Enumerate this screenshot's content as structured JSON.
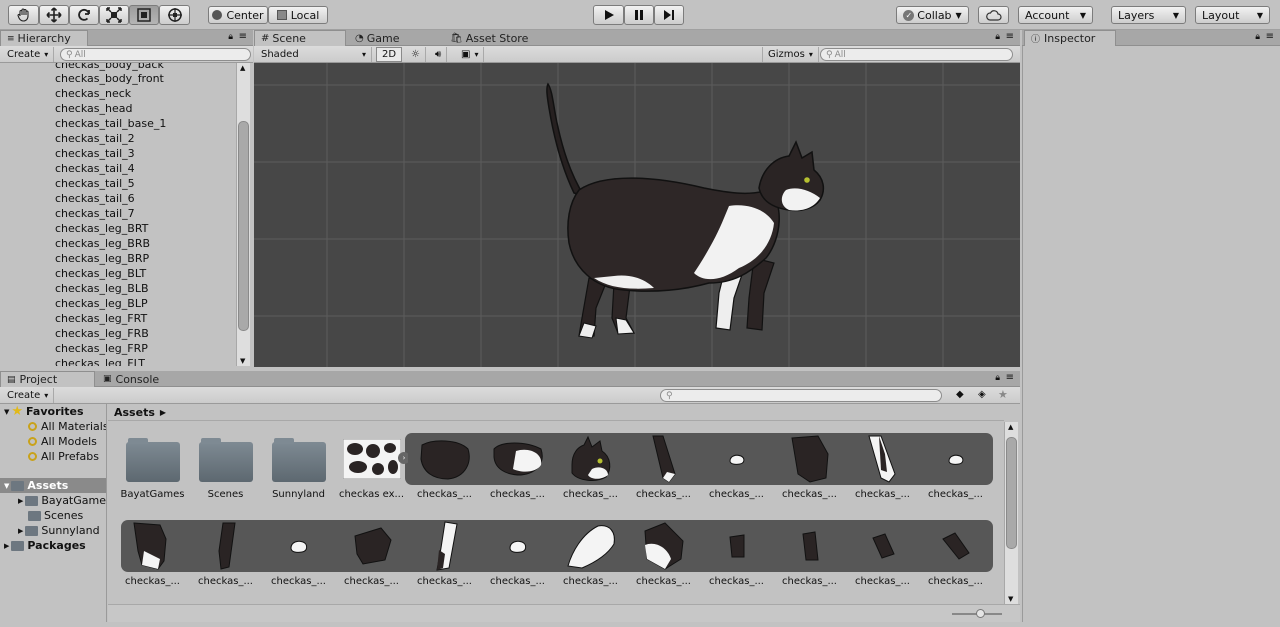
{
  "toolbar": {
    "pivot_label": "Center",
    "space_label": "Local",
    "collab_label": "Collab",
    "account_label": "Account",
    "layers_label": "Layers",
    "layout_label": "Layout"
  },
  "hierarchy": {
    "tab": "Hierarchy",
    "create": "Create",
    "search_placeholder": "All",
    "items": [
      "checkas_body_back",
      "checkas_body_front",
      "checkas_neck",
      "checkas_head",
      "checkas_tail_base_1",
      "checkas_tail_2",
      "checkas_tail_3",
      "checkas_tail_4",
      "checkas_tail_5",
      "checkas_tail_6",
      "checkas_tail_7",
      "checkas_leg_BRT",
      "checkas_leg_BRB",
      "checkas_leg_BRP",
      "checkas_leg_BLT",
      "checkas_leg_BLB",
      "checkas_leg_BLP",
      "checkas_leg_FRT",
      "checkas_leg_FRB",
      "checkas_leg_FRP",
      "checkas_leg_FLT"
    ]
  },
  "scene": {
    "tabs": [
      "Scene",
      "Game",
      "Asset Store"
    ],
    "shading": "Shaded",
    "mode_2d": "2D",
    "gizmos": "Gizmos",
    "search_placeholder": "All"
  },
  "inspector": {
    "tab": "Inspector"
  },
  "project": {
    "tabs": [
      "Project",
      "Console"
    ],
    "create": "Create",
    "breadcrumb": "Assets",
    "favorites": {
      "title": "Favorites",
      "items": [
        "All Materials",
        "All Models",
        "All Prefabs"
      ]
    },
    "assets_tree": {
      "title": "Assets",
      "items": [
        "BayatGames",
        "Scenes",
        "Sunnyland"
      ]
    },
    "packages": "Packages",
    "row1": [
      "BayatGames",
      "Scenes",
      "Sunnyland",
      "checkas ex...",
      "checkas_...",
      "checkas_...",
      "checkas_...",
      "checkas_...",
      "checkas_...",
      "checkas_...",
      "checkas_...",
      "checkas_..."
    ],
    "row2": [
      "checkas_...",
      "checkas_...",
      "checkas_...",
      "checkas_...",
      "checkas_...",
      "checkas_...",
      "checkas_...",
      "checkas_...",
      "checkas_...",
      "checkas_...",
      "checkas_...",
      "checkas_..."
    ]
  },
  "colors": {
    "scene_bg": "#474747",
    "panel_bg": "#c2c2c2",
    "selection": "#8a8a8a"
  }
}
